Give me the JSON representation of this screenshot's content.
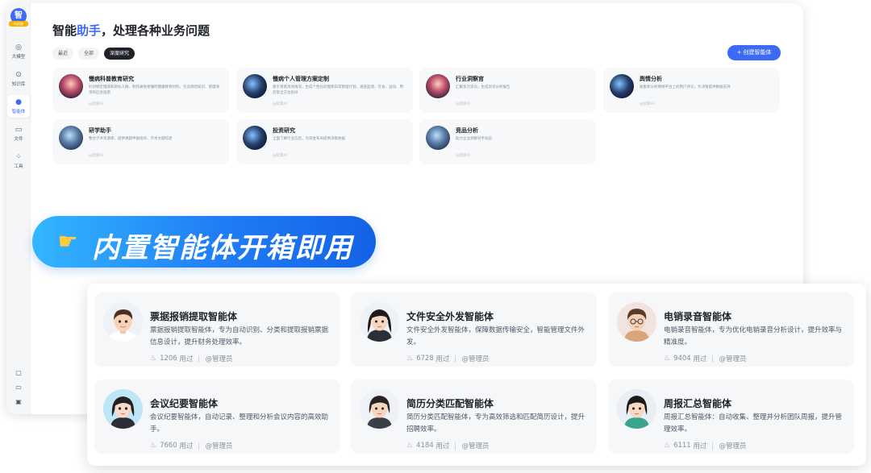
{
  "app": {
    "logo_char": "智",
    "logo_tag": "AI问答"
  },
  "sidebar": {
    "items": [
      {
        "label": "大模型",
        "icon": "model-icon"
      },
      {
        "label": "知识库",
        "icon": "knowledge-icon"
      },
      {
        "label": "智能体",
        "icon": "agent-icon",
        "active": true
      },
      {
        "label": "文件",
        "icon": "folder-icon"
      },
      {
        "label": "工具",
        "icon": "tools-icon"
      }
    ],
    "bottom_icons": [
      "chat-icon",
      "folder-icon",
      "monitor-icon"
    ]
  },
  "header": {
    "title_prefix": "智能",
    "title_highlight": "助手",
    "title_suffix": "，处理各种业务问题",
    "create_button": "创建智能体"
  },
  "filters": [
    "最近",
    "全部",
    "深度研究"
  ],
  "active_filter": "深度研究",
  "bg_cards": [
    {
      "name": "慢病科普教育研究",
      "desc": "针对特定慢病和目标人群，制作通俗易懂的健康教育材料，包含病因知识、管理清单和应急指南",
      "by": "@智库AI"
    },
    {
      "name": "慢病个人管理方案定制",
      "desc": "基于患者具体情况，生成个性化的慢病日常管理计划，涵盖监测、饮食、运动、用药等全方位指导",
      "by": "@智库AI"
    },
    {
      "name": "行业洞察官",
      "desc": "汇聚多元资讯，生成资讯分析报告",
      "by": "@智库AI"
    },
    {
      "name": "舆情分析",
      "desc": "收集和分析网络平台上的用户评论，为决策提供数据支持",
      "by": "@智库AI"
    },
    {
      "name": "研学助手",
      "desc": "整合学术资源库，提供课题申报指导、学术文献综述",
      "by": "@智库AI"
    },
    {
      "name": "投资研究",
      "desc": "全面了解行业信息，为资金布局提供决策依据",
      "by": "@智库AI"
    },
    {
      "name": "竞品分析",
      "desc": "助力企业洞察对手动态",
      "by": "@智库AI"
    }
  ],
  "banner": {
    "text": "内置智能体开箱即用",
    "icon": "pointing-hand-icon"
  },
  "agents": [
    {
      "name": "票据报销提取智能体",
      "desc": "票据报销提取智能体，专为自动识别、分类和提取报销票据信息设计，提升财务处理效率。",
      "uses": "1206",
      "uses_suffix": "用过",
      "owner": "@管理员"
    },
    {
      "name": "文件安全外发智能体",
      "desc": "文件安全外发智能体，保障数据传输安全，智能管理文件外发。",
      "uses": "6728",
      "uses_suffix": "用过",
      "owner": "@管理员"
    },
    {
      "name": "电销录音智能体",
      "desc": "电销录音智能体，专为优化电销录音分析设计，提升效率与精准度。",
      "uses": "9404",
      "uses_suffix": "用过",
      "owner": "@管理员"
    },
    {
      "name": "会议纪要智能体",
      "desc": "会议纪要智能体，自动记录、整理和分析会议内容的高效助手。",
      "uses": "7660",
      "uses_suffix": "用过",
      "owner": "@管理员"
    },
    {
      "name": "简历分类匹配智能体",
      "desc": "简历分类匹配智能体，专为高效筛选和匹配简历设计，提升招聘效率。",
      "uses": "4184",
      "uses_suffix": "用过",
      "owner": "@管理员"
    },
    {
      "name": "周报汇总智能体",
      "desc": "周报汇总智能体：自动收集、整理并分析团队周报，提升管理效率。",
      "uses": "6111",
      "uses_suffix": "用过",
      "owner": "@管理员"
    }
  ],
  "colors": {
    "accent": "#3d6af5",
    "banner_start": "#33b6ff",
    "banner_end": "#1462e6"
  }
}
